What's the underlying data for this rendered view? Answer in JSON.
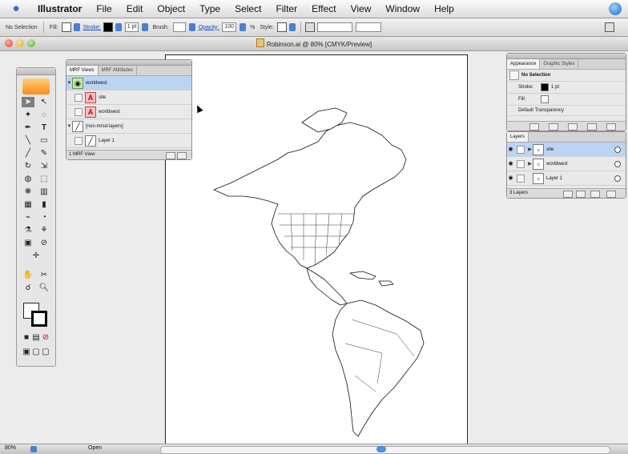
{
  "menubar": {
    "app_name": "Illustrator",
    "items": [
      "File",
      "Edit",
      "Object",
      "Type",
      "Select",
      "Filter",
      "Effect",
      "View",
      "Window",
      "Help"
    ]
  },
  "control_bar": {
    "selection": "No Selection",
    "fill_label": "Fill:",
    "stroke_label": "Stroke:",
    "stroke_weight": "1 pt",
    "brush_label": "Brush:",
    "opacity_label": "Opacity:",
    "opacity_value": "100",
    "opacity_unit": "%",
    "style_label": "Style:"
  },
  "document": {
    "title": "Robinson.ai @ 80% [CMYK/Preview]"
  },
  "mrf_panel": {
    "tabs": [
      "MRF Views",
      "MRF Attributes"
    ],
    "rows": [
      {
        "name": "worldwest",
        "selected": true,
        "icon": "globe-icon"
      },
      {
        "name": "site",
        "selected": false,
        "icon": "text-a-icon"
      },
      {
        "name": "worldwest",
        "selected": false,
        "icon": "text-a-icon"
      },
      {
        "name": "[non-mrsd-layers]",
        "selected": false,
        "icon": "pen-icon"
      },
      {
        "name": "Layer 1",
        "selected": false,
        "icon": "pen-icon"
      }
    ],
    "footer": "1 MRF View"
  },
  "appearance_panel": {
    "tabs": [
      "Appearance",
      "Graphic Styles"
    ],
    "header": "No Selection",
    "rows": [
      {
        "label": "Stroke:",
        "value": "1 pt"
      },
      {
        "label": "Fill:",
        "value": ""
      },
      {
        "label": "Default Transparency",
        "value": ""
      }
    ]
  },
  "layers_panel": {
    "tabs": [
      "Layers"
    ],
    "rows": [
      {
        "name": "site",
        "selected": true
      },
      {
        "name": "worldwest",
        "selected": false
      },
      {
        "name": "Layer 1",
        "selected": false
      }
    ],
    "footer": "3 Layers"
  },
  "statusbar": {
    "zoom": "80%",
    "mode": "Open"
  },
  "colors": {
    "accent": "#2a6fd6",
    "selection_row": "#bcd4f4",
    "toolbox_logo": "#ff8a18"
  }
}
